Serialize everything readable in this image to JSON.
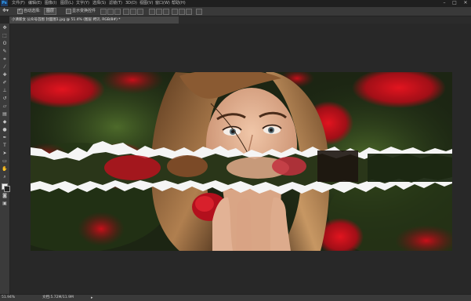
{
  "app": {
    "logo": "Ps"
  },
  "menu": {
    "items": [
      "文件(F)",
      "编辑(E)",
      "图像(I)",
      "图层(L)",
      "文字(Y)",
      "选择(S)",
      "滤镜(T)",
      "3D(D)",
      "视图(V)",
      "窗口(W)",
      "帮助(H)"
    ]
  },
  "window_controls": {
    "minimize": "–",
    "maximize": "□",
    "close": "✕"
  },
  "options": {
    "auto_select_label": "自动选择:",
    "auto_select_value": "图层",
    "show_transform_label": "显示变换控件"
  },
  "document_tab": {
    "title": "小清新女 公众号首图 封面图1.jpg @ 51.4% (图层 拷贝, RGB/8#) *"
  },
  "status": {
    "zoom": "51.94%",
    "doc": "文档:5.72M/11.9M",
    "arrow": "▸"
  },
  "colors": {
    "foreground": "#f0f0f0",
    "background": "#222222",
    "accent": "#31a8ff"
  }
}
